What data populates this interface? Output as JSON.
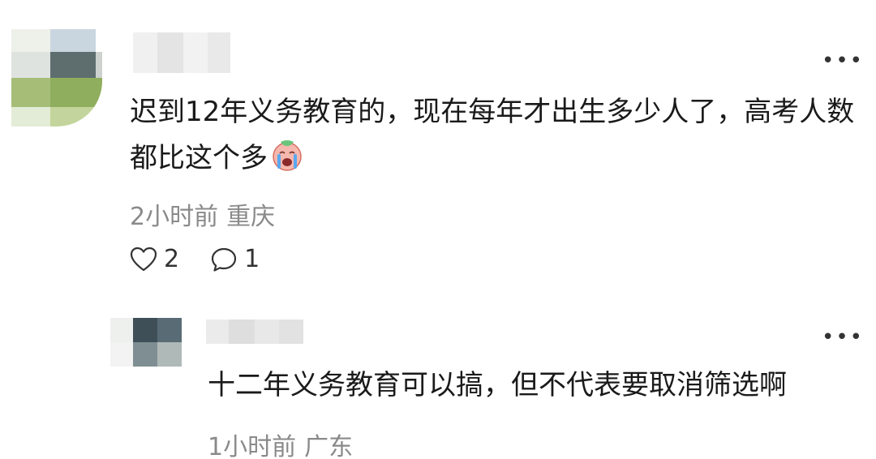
{
  "comment": {
    "text": "迟到12年义务教育的，现在每年才出生多少人了，高考人数都比这个多",
    "emoji": "crying-face-emoji",
    "time": "2小时前",
    "location": "重庆",
    "likes": "2",
    "replies": "1"
  },
  "reply": {
    "text": "十二年义务教育可以搞，但不代表要取消筛选啊",
    "time": "1小时前",
    "location": "广东"
  },
  "colors": {
    "text": "#1a1a1a",
    "meta": "#8a8a8a",
    "icon": "#333333"
  }
}
